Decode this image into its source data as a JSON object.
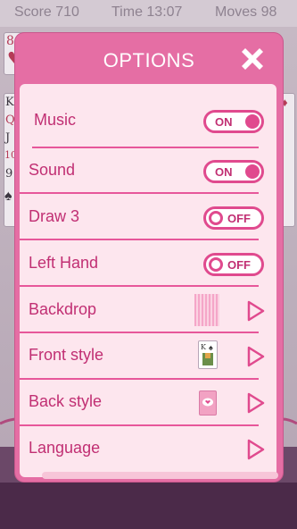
{
  "game": {
    "score_label": "Score 710",
    "time_label": "Time 13:07",
    "moves_label": "Moves 98",
    "visible_cards": [
      "8",
      "K",
      "Q",
      "J",
      "10",
      "9"
    ]
  },
  "dialog": {
    "title": "OPTIONS",
    "close_icon": "close-x-icon",
    "colors": {
      "header": "#e56ea4",
      "panel": "#fde6ee",
      "accent": "#e04a8e",
      "text": "#c12f73"
    },
    "settings": [
      {
        "label": "Music",
        "type": "toggle",
        "state": "ON"
      },
      {
        "label": "Sound",
        "type": "toggle",
        "state": "ON"
      },
      {
        "label": "Draw 3",
        "type": "toggle",
        "state": "OFF"
      },
      {
        "label": "Left Hand",
        "type": "toggle",
        "state": "OFF"
      },
      {
        "label": "Backdrop",
        "type": "nav",
        "icon": "backdrop-preview-icon"
      },
      {
        "label": "Front style",
        "type": "nav",
        "icon": "front-card-preview-icon"
      },
      {
        "label": "Back style",
        "type": "nav",
        "icon": "card-back-preview-icon"
      },
      {
        "label": "Language",
        "type": "nav",
        "icon": "chevron-right-icon"
      }
    ]
  }
}
